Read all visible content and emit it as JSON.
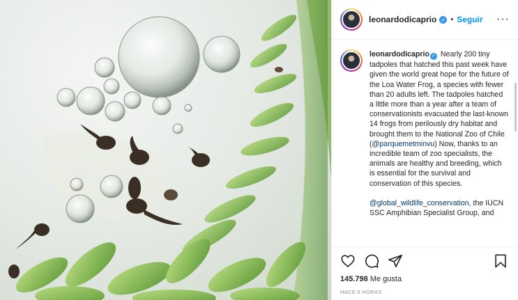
{
  "header": {
    "username": "leonardodicaprio",
    "separator": "•",
    "follow_label": "Seguir",
    "more_label": "···"
  },
  "caption": {
    "username": "leonardodicaprio",
    "text_1": "Nearly 200 tiny tadpoles that hatched this past week have given the world great hope for the future of the Loa Water Frog, a species with fewer than 20 adults left. The tadpoles hatched a little more than a year after a team of conservationists evacuated the last-known 14 frogs from perilously dry habitat and brought them to the National Zoo of Chile (",
    "mention_1": "@parquemetminvu",
    "text_2": ") Now, thanks to an incredible team of zoo specialists, the animals are healthy and breeding, which is essential for the survival and conservation of this species.",
    "mention_2": "@global_wildlife_conservation",
    "text_3": ", the IUCN SSC Amphibian Specialist Group, and"
  },
  "stats": {
    "likes_count": "145.798",
    "likes_label": "Me gusta",
    "time": "HACE 6 HORAS"
  },
  "icons": {
    "like": "heart-icon",
    "comment": "comment-icon",
    "share": "share-icon",
    "save": "bookmark-icon",
    "verified": "verified-badge-icon"
  },
  "colors": {
    "follow": "#0095f6",
    "verified": "#3897f0",
    "link": "#00376b",
    "muted": "#8e8e8e"
  }
}
